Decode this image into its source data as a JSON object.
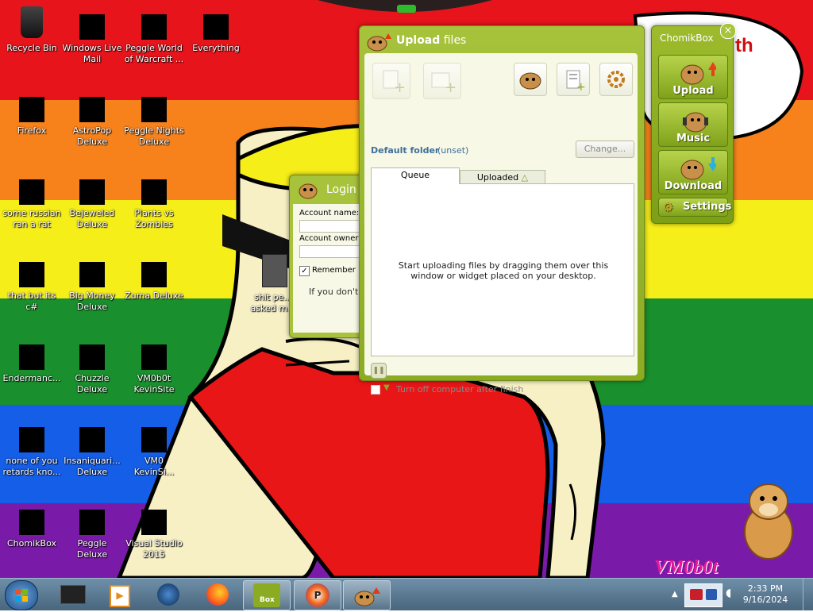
{
  "desktop": {
    "icons": [
      {
        "label": "Recycle Bin",
        "icon": "recycle-bin-icon"
      },
      {
        "label": "Windows Live Mail",
        "icon": "mail-icon"
      },
      {
        "label": "Peggle World of Warcraft ...",
        "icon": "game-icon"
      },
      {
        "label": "Everything",
        "icon": "search-app-icon"
      },
      {
        "label": "Firefox",
        "icon": "firefox-icon"
      },
      {
        "label": "AstroPop Deluxe",
        "icon": "game-icon"
      },
      {
        "label": "Peggle Nights Deluxe",
        "icon": "game-icon"
      },
      {
        "label": "some russian ran a rat",
        "icon": "file-icon"
      },
      {
        "label": "Bejeweled Deluxe",
        "icon": "game-icon"
      },
      {
        "label": "Plants vs Zombies",
        "icon": "game-icon"
      },
      {
        "label": "that but its c#",
        "icon": "file-icon"
      },
      {
        "label": "Big Money Deluxe",
        "icon": "game-icon"
      },
      {
        "label": "Zuma Deluxe",
        "icon": "game-icon"
      },
      {
        "label": "Endermanc...",
        "icon": "app-icon"
      },
      {
        "label": "Chuzzle Deluxe",
        "icon": "game-icon"
      },
      {
        "label": "VM0b0t KevinSite",
        "icon": "app-icon"
      },
      {
        "label": "none of you retards kno...",
        "icon": "file-icon"
      },
      {
        "label": "Insaniquari... Deluxe",
        "icon": "game-icon"
      },
      {
        "label": "VM0 KevinSi...",
        "icon": "app-icon"
      },
      {
        "label": "ChomikBox",
        "icon": "chomikbox-icon"
      },
      {
        "label": "Peggle Deluxe",
        "icon": "game-icon"
      },
      {
        "label": "Visual Studio 2015",
        "icon": "visual-studio-icon"
      },
      {
        "label": "shit pe... asked m...",
        "icon": "file-icon"
      }
    ],
    "wallpaper_text": {
      "speech": "th",
      "signature": "VM0b0t"
    }
  },
  "upload_window": {
    "title_bold": "Upload",
    "title_rest": " files",
    "default_folder_label": "Default folder",
    "default_folder_value": "(unset)",
    "change_button": "Change...",
    "tabs": [
      "Queue",
      "Uploaded"
    ],
    "active_tab": "Queue",
    "empty_message": "Start uploading files by dragging them over this window or widget placed on your desktop.",
    "turn_off_label": "Turn off computer after finish"
  },
  "login_window": {
    "title": "Login",
    "account_name_label": "Account name:",
    "account_owner_label": "Account owner",
    "remember_label": "Remember pa",
    "remember_checked": true,
    "info_text": "If you don't h"
  },
  "chomik_widget": {
    "title": "ChomikBox",
    "buttons": [
      "Upload",
      "Music",
      "Download",
      "Settings"
    ]
  },
  "taskbar": {
    "time": "2:33 PM",
    "date": "9/16/2024",
    "pinned": [
      {
        "name": "start-button"
      },
      {
        "name": "app-icon"
      },
      {
        "name": "media-player-icon"
      },
      {
        "name": "globe-icon"
      },
      {
        "name": "firefox-icon"
      },
      {
        "name": "chomikbox-icon",
        "label": "Box",
        "open": true
      },
      {
        "name": "peggle-icon",
        "open": true
      },
      {
        "name": "upload-icon",
        "open": true
      }
    ]
  },
  "colors": {
    "accent_green": "#8aab22",
    "taskbar": "#5b7b93"
  }
}
